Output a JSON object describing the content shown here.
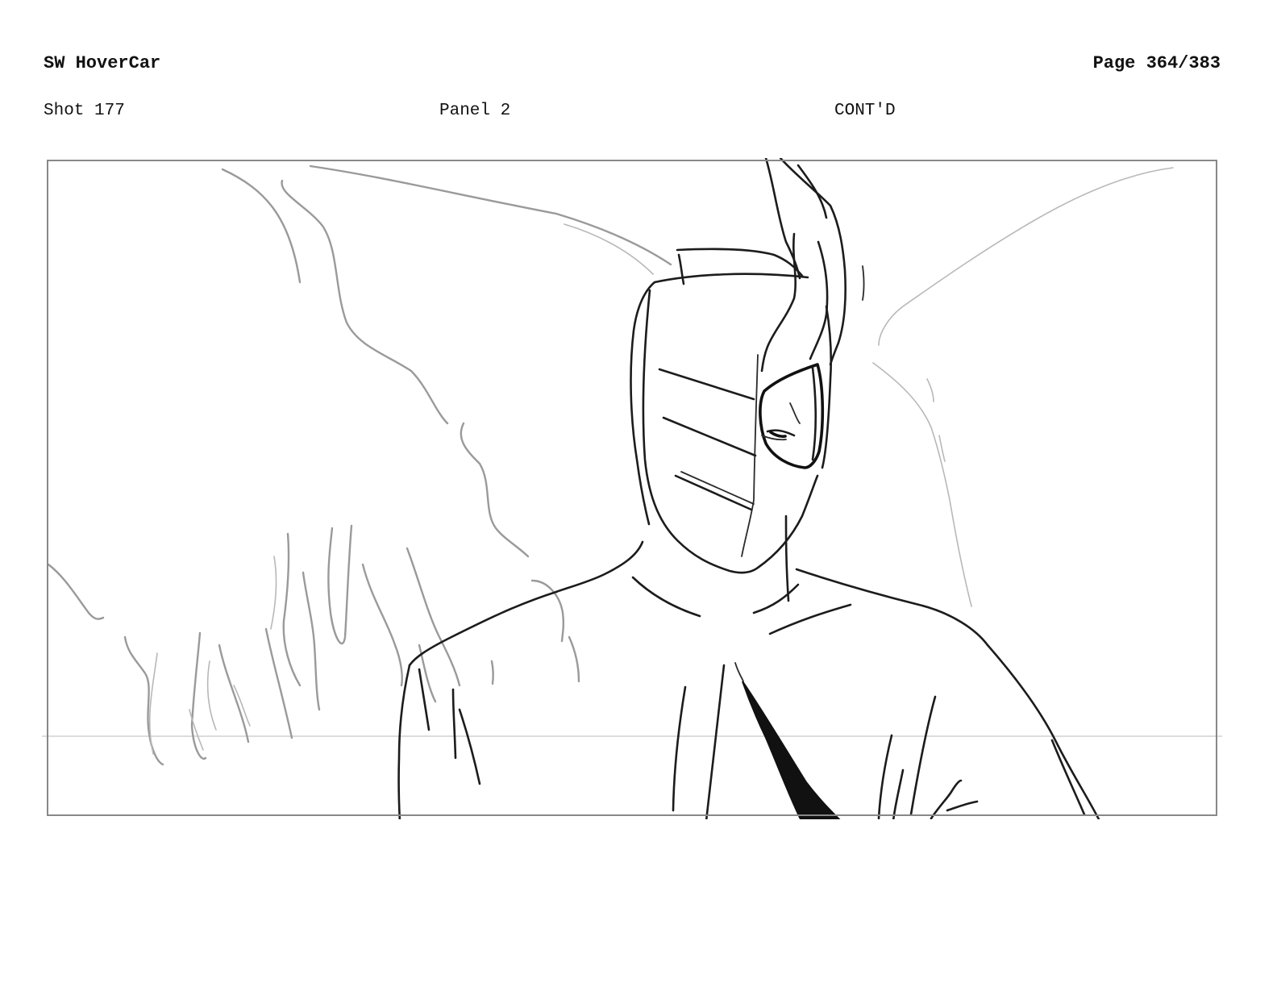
{
  "header": {
    "project_title": "SW HoverCar",
    "page_number": "Page 364/383"
  },
  "panel_info": {
    "shot": "Shot 177",
    "panel": "Panel 2",
    "continuity": "CONT'D"
  },
  "colors": {
    "ink": "#1c1c1c",
    "pencil": "#9a9a9a",
    "frame": "#888888",
    "guide": "#d0d0d0"
  }
}
